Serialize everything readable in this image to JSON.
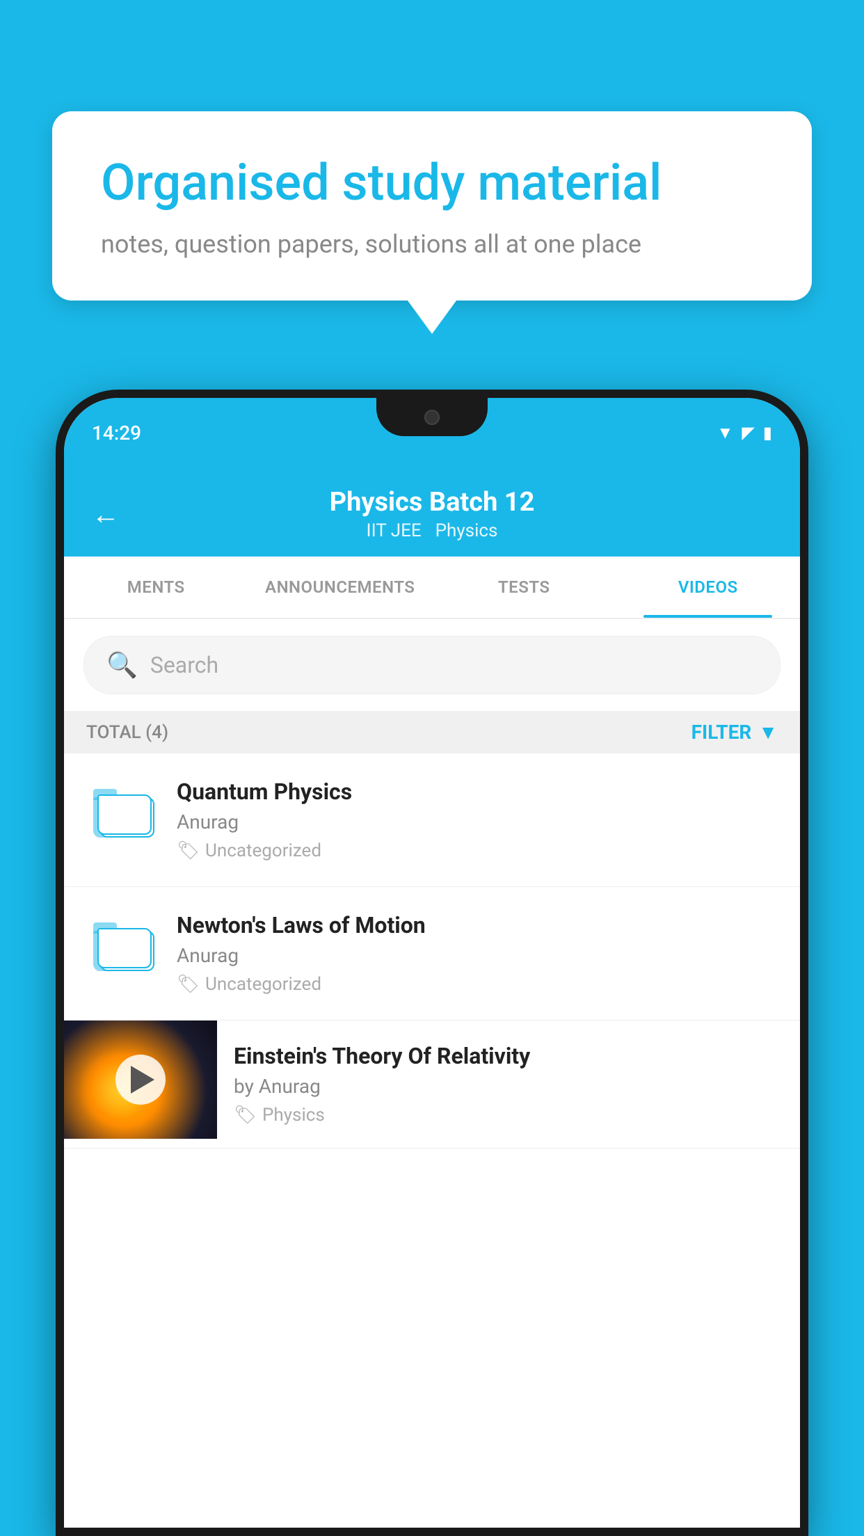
{
  "background_color": "#1ab8e8",
  "bubble": {
    "title": "Organised study material",
    "subtitle": "notes, question papers, solutions all at one place"
  },
  "phone": {
    "status_bar": {
      "time": "14:29",
      "wifi": "▼",
      "signal": "▲",
      "battery": "▮"
    },
    "header": {
      "title": "Physics Batch 12",
      "subtitle_part1": "IIT JEE",
      "subtitle_part2": "Physics",
      "back_label": "←"
    },
    "tabs": [
      {
        "label": "MENTS",
        "active": false
      },
      {
        "label": "ANNOUNCEMENTS",
        "active": false
      },
      {
        "label": "TESTS",
        "active": false
      },
      {
        "label": "VIDEOS",
        "active": true
      }
    ],
    "search": {
      "placeholder": "Search"
    },
    "filter_row": {
      "total_label": "TOTAL (4)",
      "filter_label": "FILTER"
    },
    "videos": [
      {
        "title": "Quantum Physics",
        "author": "Anurag",
        "tag": "Uncategorized",
        "has_thumbnail": false
      },
      {
        "title": "Newton's Laws of Motion",
        "author": "Anurag",
        "tag": "Uncategorized",
        "has_thumbnail": false
      },
      {
        "title": "Einstein's Theory Of Relativity",
        "author": "by Anurag",
        "tag": "Physics",
        "has_thumbnail": true
      }
    ]
  }
}
